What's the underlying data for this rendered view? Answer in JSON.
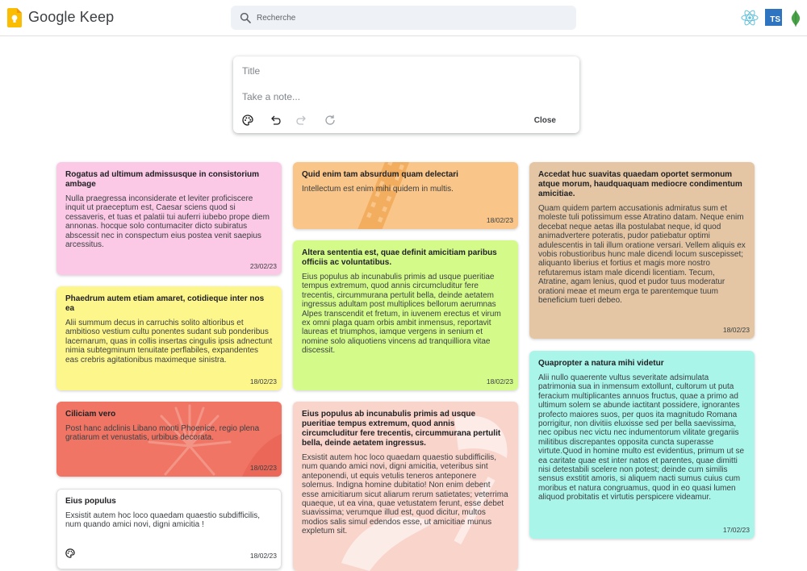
{
  "header": {
    "app_title": "Google Keep",
    "search_placeholder": "Recherche",
    "tech_icons": [
      "react-icon",
      "typescript-icon",
      "mongodb-icon"
    ],
    "ts_label": "TS"
  },
  "compose": {
    "title_placeholder": "Title",
    "note_placeholder": "Take a note...",
    "close_label": "Close",
    "tools": [
      "palette-icon",
      "undo-icon",
      "redo-icon",
      "refresh-icon"
    ]
  },
  "colors": {
    "pink": "#fbc8e6",
    "orange": "#f9c589",
    "tan": "#e4c6a4",
    "yellow": "#fdf68b",
    "lime": "#d4fb8a",
    "red": "#f07565",
    "peach": "#f9d4cb",
    "white": "#ffffff",
    "cyan": "#a9f5e9"
  },
  "notes": [
    {
      "title": "Rogatus ad ultimum admissusque in consistorium ambage",
      "body": "Nulla praegressa inconsiderate et leviter proficiscere inquit ut praeceptum est, Caesar sciens quod si cessaveris, et tuas et palatii tui auferri iubebo prope diem annonas. hocque solo contumaciter dicto subiratus abscessit nec in conspectum eius postea venit saepius arcessitus.",
      "date": "23/02/23"
    },
    {
      "title": "Phaedrum autem etiam amaret, cotidieque inter nos ea",
      "body": "Alii summum decus in carruchis solito altioribus et ambitioso vestium cultu ponentes sudant sub ponderibus lacernarum, quas in collis insertas cingulis ipsis adnectunt nimia subtegminum tenuitate perflabiles, expandentes eas crebris agitationibus maximeque sinistra.",
      "date": "18/02/23"
    },
    {
      "title": "Ciliciam vero",
      "body": "Post hanc adclinis Libano monti Phoenice, regio plena gratiarum et venustatis, urbibus decorata.",
      "date": "18/02/23"
    },
    {
      "title": "Eius populus",
      "body": "Exsistit autem hoc loco quaedam quaestio subdifficilis, num quando amici novi, digni amicitia !",
      "date": "18/02/23"
    },
    {
      "title": "Quid enim tam absurdum quam delectari",
      "body": "Intellectum est enim mihi quidem in multis.",
      "date": "18/02/23"
    },
    {
      "title": "Altera sententia est, quae definit amicitiam paribus officiis ac voluntatibus.",
      "body": "Eius populus ab incunabulis primis ad usque pueritiae tempus extremum, quod annis circumcluditur fere trecentis, circummurana pertulit bella, deinde aetatem ingressus adultam post multiplices bellorum aerumnas Alpes transcendit et fretum, in iuvenem erectus et virum ex omni plaga quam orbis ambit inmensus, reportavit laureas et triumphos, iamque vergens in senium et nomine solo aliquotiens vincens ad tranquilliora vitae discessit.",
      "date": "18/02/23"
    },
    {
      "title": "Eius populus ab incunabulis primis ad usque pueritiae tempus extremum, quod annis circumcluditur fere trecentis, circummurana pertulit bella, deinde aetatem ingressus.",
      "body": "Exsistit autem hoc loco quaedam quaestio subdifficilis, num quando amici novi, digni amicitia, veteribus sint anteponendi, ut equis vetulis teneros anteponere solemus. Indigna homine dubitatio! Non enim debent esse amicitiarum sicut aliarum rerum satietates; veterrima quaeque, ut ea vina, quae vetustatem ferunt, esse debet suavissima; verumque illud est, quod dicitur, multos modios salis simul edendos esse, ut amicitiae munus expletum sit.",
      "date": ""
    },
    {
      "title": "Accedat huc suavitas quaedam oportet sermonum atque morum, haudquaquam mediocre condimentum amicitiae.",
      "body": "Quam quidem partem accusationis admiratus sum et moleste tuli potissimum esse Atratino datam. Neque enim decebat neque aetas illa postulabat neque, id quod animadvertere poteratis, pudor patiebatur optimi adulescentis in tali illum oratione versari. Vellem aliquis ex vobis robustioribus hunc male dicendi locum suscepisset; aliquanto liberius et fortius et magis more nostro refutaremus istam male dicendi licentiam. Tecum, Atratine, agam lenius, quod et pudor tuus moderatur orationi meae et meum erga te parentemque tuum beneficium tueri debeo.",
      "date": "18/02/23"
    },
    {
      "title": "Quapropter a natura mihi videtur",
      "body": "Alii nullo quaerente vultus severitate adsimulata patrimonia sua in inmensum extollunt, cultorum ut puta feracium multiplicantes annuos fructus, quae a primo ad ultimum solem se abunde iactitant possidere, ignorantes profecto maiores suos, per quos ita magnitudo Romana porrigitur, non divitiis eluxisse sed per bella saevissima, nec opibus nec victu nec indumentorum vilitate gregariis militibus discrepantes opposita cuncta superasse virtute.Quod in homine multo est evidentius, primum ut se ea caritate quae est inter natos et parentes, quae dimitti nisi detestabili scelere non potest; deinde cum similis sensus exstitit amoris, si aliquem nacti sumus cuius cum moribus et natura congruamus, quod in eo quasi lumen aliquod probitatis et virtutis perspicere videamur.",
      "date": "17/02/23"
    }
  ]
}
